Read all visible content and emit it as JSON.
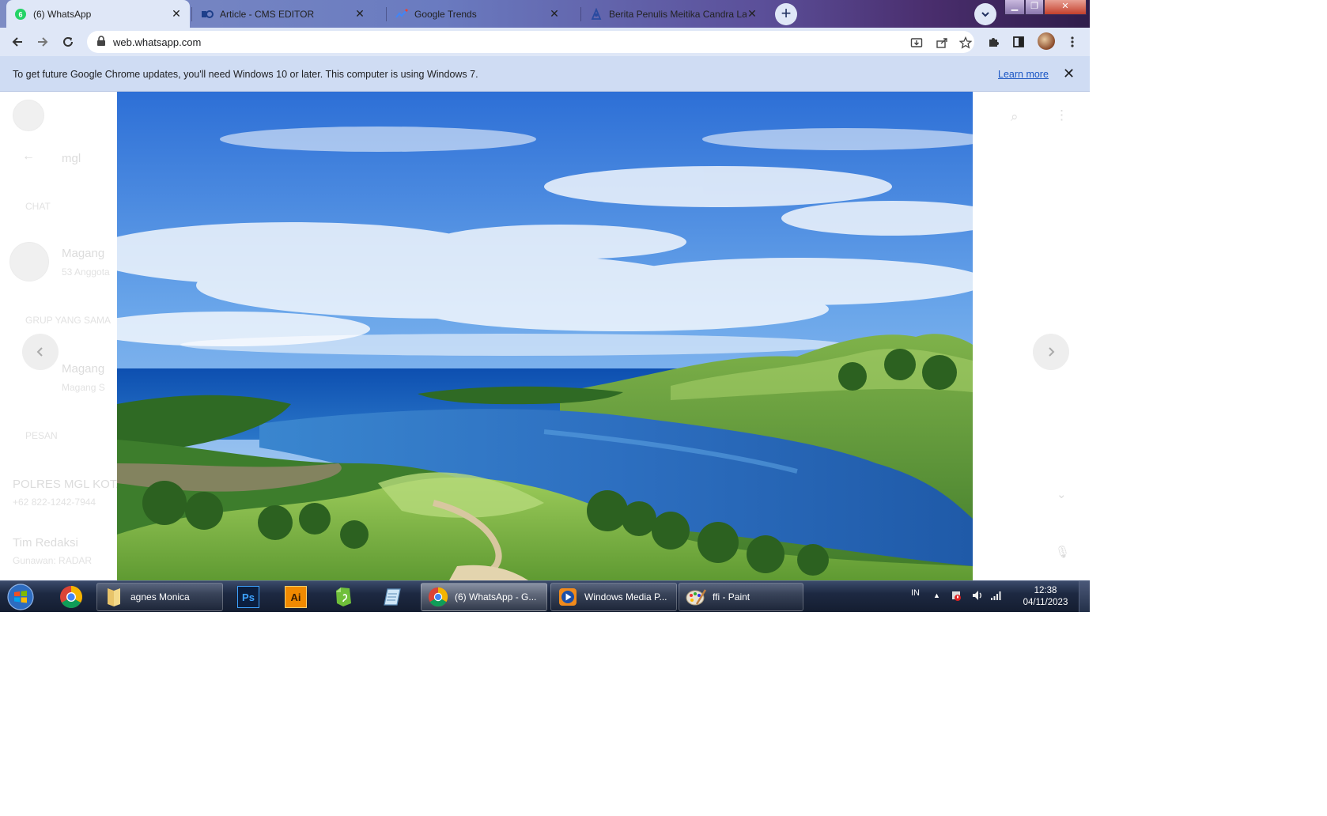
{
  "browser": {
    "tabs": [
      {
        "title": "(6) WhatsApp",
        "favicon": "whatsapp-icon",
        "active": true
      },
      {
        "title": "Article - CMS EDITOR",
        "favicon": "cms-icon",
        "active": false
      },
      {
        "title": "Google Trends",
        "favicon": "trends-icon",
        "active": false
      },
      {
        "title": "Berita Penulis Meitika Candra Lar",
        "favicon": "writer-icon",
        "active": false
      }
    ],
    "new_tab_label": "+",
    "url": "web.whatsapp.com"
  },
  "infobar": {
    "message": "To get future Google Chrome updates, you'll need Windows 10 or later. This computer is using Windows 7.",
    "learn_more": "Learn more"
  },
  "background_app": {
    "search_text": "mgl",
    "section_chat": "CHAT",
    "chat_name_1": "Magang",
    "chat_sub_1": "53 Anggota",
    "section_groups": "GRUP YANG SAMA",
    "chat_name_2": "Magang",
    "chat_sub_2": "Magang S",
    "section_messages": "PESAN",
    "msg_name_1": "POLRES MGL KOTA",
    "msg_sub_1": "+62 822-1242-7944",
    "msg_name_2": "Tim Redaksi",
    "msg_sub_2": "Gunawan: RADAR"
  },
  "taskbar": {
    "items": [
      {
        "label": "agnes Monica",
        "icon": "folder-icon"
      },
      {
        "label": "(6) WhatsApp - G...",
        "icon": "chrome-icon",
        "active": true
      },
      {
        "label": "Windows Media P...",
        "icon": "media-player-icon"
      },
      {
        "label": "ffi - Paint",
        "icon": "paint-icon"
      }
    ],
    "pinned": [
      "chrome-icon",
      "photoshop-icon",
      "illustrator-icon",
      "evernote-icon",
      "notepad-icon"
    ],
    "photoshop_text": "Ps",
    "illustrator_text": "Ai",
    "language": "IN",
    "time": "12:38",
    "date": "04/11/2023"
  }
}
